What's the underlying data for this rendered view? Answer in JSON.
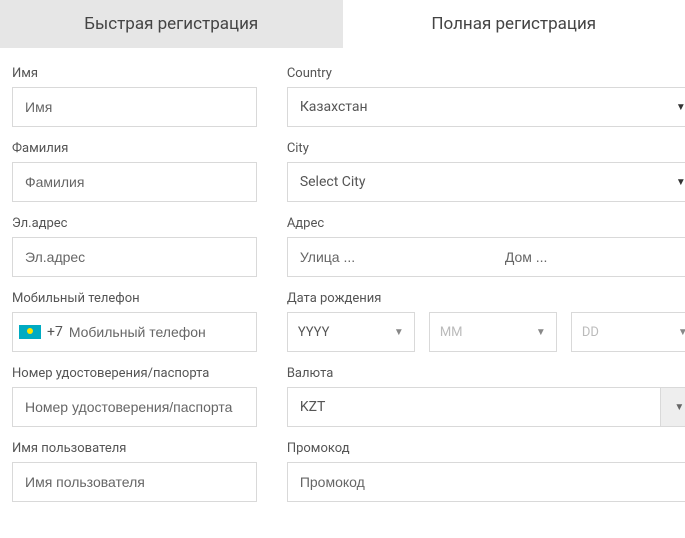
{
  "tabs": {
    "quick": "Быстрая регистрация",
    "full": "Полная регистрация"
  },
  "left": {
    "name": {
      "label": "Имя",
      "placeholder": "Имя"
    },
    "surname": {
      "label": "Фамилия",
      "placeholder": "Фамилия"
    },
    "email": {
      "label": "Эл.адрес",
      "placeholder": "Эл.адрес"
    },
    "mobile": {
      "label": "Мобильный телефон",
      "prefix": "+7",
      "placeholder": "Мобильный телефон"
    },
    "passport": {
      "label": "Номер удостоверения/паспорта",
      "placeholder": "Номер удостоверения/паспорта"
    },
    "username": {
      "label": "Имя пользователя",
      "placeholder": "Имя пользователя"
    }
  },
  "right": {
    "country": {
      "label": "Country",
      "value": "Казахстан"
    },
    "city": {
      "label": "City",
      "value": "Select City"
    },
    "address": {
      "label": "Адрес",
      "street_placeholder": "Улица ...",
      "house_placeholder": "Дом ..."
    },
    "dob": {
      "label": "Дата рождения",
      "year": "YYYY",
      "month": "MM",
      "day": "DD"
    },
    "currency": {
      "label": "Валюта",
      "value": "KZT"
    },
    "promo": {
      "label": "Промокод",
      "placeholder": "Промокод"
    }
  }
}
